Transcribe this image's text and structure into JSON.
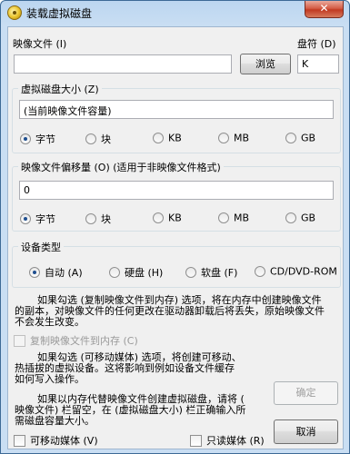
{
  "window": {
    "title": "装载虚拟磁盘",
    "close_glyph": "✕"
  },
  "image_file": {
    "label": "映像文件 (I)",
    "value": "",
    "browse_label": "浏览"
  },
  "drive_letter": {
    "label": "盘符 (D)",
    "value": "K"
  },
  "disk_size": {
    "title": "虚拟磁盘大小 (Z)",
    "value": "(当前映像文件容量)",
    "units": [
      "字节",
      "块",
      "KB",
      "MB",
      "GB"
    ],
    "selected_unit": "字节"
  },
  "offset": {
    "title": "映像文件偏移量 (O) (适用于非映像文件格式)",
    "value": "0",
    "units": [
      "字节",
      "块",
      "KB",
      "MB",
      "GB"
    ],
    "selected_unit": "字节"
  },
  "device_type": {
    "title": "设备类型",
    "options": [
      "自动 (A)",
      "硬盘 (H)",
      "软盘 (F)",
      "CD/DVD-ROM"
    ],
    "selected": "自动 (A)"
  },
  "notes": {
    "copy_note_1": "如果勾选 (复制映像文件到内存) 选项，将在内存中创建映像文件",
    "copy_note_2": "的副本，对映像文件的任何更改在驱动器卸载后将丢失，原始映像文件",
    "copy_note_3": "不会发生改变。",
    "removable_note_1": "如果勾选 (可移动媒体) 选项，将创建可移动、",
    "removable_note_2": "热插拔的虚拟设备。这将影响到例如设备文件缓存",
    "removable_note_3": "如何写入操作。",
    "memory_note_1": "如果以内存代替映像文件创建虚拟磁盘，请将 (",
    "memory_note_2": "映像文件) 栏留空，在 (虚拟磁盘大小) 栏正确输入所",
    "memory_note_3": "需磁盘容量大小。"
  },
  "checkboxes": {
    "copy_to_memory": "复制映像文件到内存 (C)",
    "removable": "可移动媒体 (V)",
    "readonly": "只读媒体 (R)"
  },
  "buttons": {
    "ok": "确定",
    "cancel": "取消"
  }
}
